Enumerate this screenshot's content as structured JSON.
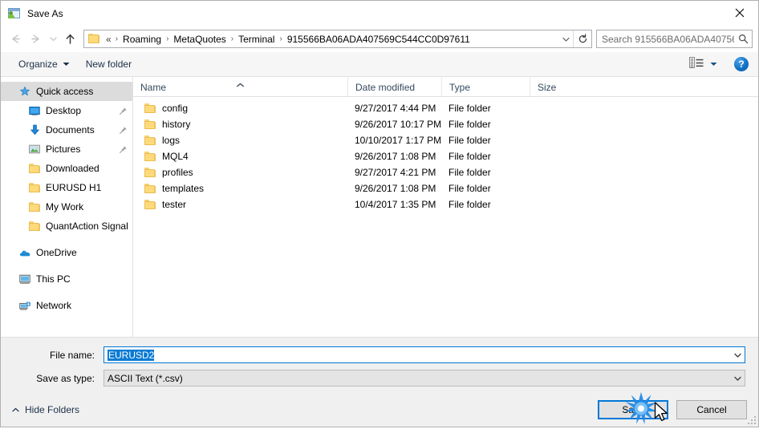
{
  "window": {
    "title": "Save As",
    "icon": "save-as-app-icon",
    "close_label": "×"
  },
  "navigation": {
    "back_icon": "back-arrow-icon",
    "forward_icon": "forward-arrow-icon",
    "recent_icon": "recent-locations-chevron-icon",
    "up_icon": "up-arrow-icon"
  },
  "address": {
    "folder_icon": "folder-icon",
    "lead": "«",
    "crumbs": [
      "Roaming",
      "MetaQuotes",
      "Terminal",
      "915566BA06ADA407569C544CC0D97611"
    ],
    "separator": "›",
    "dropdown_icon": "chevron-down-icon",
    "refresh_icon": "refresh-icon"
  },
  "search": {
    "placeholder": "Search 915566BA06ADA40756...",
    "icon": "search-icon"
  },
  "toolbar": {
    "organize_label": "Organize",
    "organize_caret": "caret-down-icon",
    "new_folder_label": "New folder",
    "view_icon": "view-layout-icon",
    "view_caret": "caret-down-icon",
    "help_label": "?",
    "help_icon": "help-circle-icon"
  },
  "sidebar": {
    "groups": [
      {
        "items": [
          {
            "label": "Quick access",
            "icon": "star-pin-icon",
            "selected": true,
            "pinned": false,
            "indent": 0
          },
          {
            "label": "Desktop",
            "icon": "desktop-icon",
            "selected": false,
            "pinned": true,
            "indent": 1
          },
          {
            "label": "Documents",
            "icon": "documents-download-icon",
            "selected": false,
            "pinned": true,
            "indent": 1
          },
          {
            "label": "Pictures",
            "icon": "pictures-icon",
            "selected": false,
            "pinned": true,
            "indent": 1
          },
          {
            "label": "Downloaded",
            "icon": "folder-icon",
            "selected": false,
            "pinned": false,
            "indent": 1
          },
          {
            "label": "EURUSD H1",
            "icon": "folder-icon",
            "selected": false,
            "pinned": false,
            "indent": 1
          },
          {
            "label": "My Work",
            "icon": "folder-icon",
            "selected": false,
            "pinned": false,
            "indent": 1
          },
          {
            "label": "QuantAction Signal",
            "icon": "folder-icon",
            "selected": false,
            "pinned": false,
            "indent": 1
          }
        ]
      },
      {
        "items": [
          {
            "label": "OneDrive",
            "icon": "onedrive-cloud-icon",
            "selected": false,
            "pinned": false,
            "indent": 0
          }
        ]
      },
      {
        "items": [
          {
            "label": "This PC",
            "icon": "this-pc-monitor-icon",
            "selected": false,
            "pinned": false,
            "indent": 0
          }
        ]
      },
      {
        "items": [
          {
            "label": "Network",
            "icon": "network-icon",
            "selected": false,
            "pinned": false,
            "indent": 0
          }
        ]
      }
    ]
  },
  "filelist": {
    "columns": [
      {
        "key": "name",
        "label": "Name"
      },
      {
        "key": "date",
        "label": "Date modified"
      },
      {
        "key": "type",
        "label": "Type"
      },
      {
        "key": "size",
        "label": "Size"
      }
    ],
    "sort": {
      "column": "Name",
      "direction": "ascending",
      "icon": "sort-ascending-caret-icon"
    },
    "rows": [
      {
        "name": "config",
        "date": "9/27/2017 4:44 PM",
        "type": "File folder",
        "size": "",
        "icon": "folder-icon"
      },
      {
        "name": "history",
        "date": "9/26/2017 10:17 PM",
        "type": "File folder",
        "size": "",
        "icon": "folder-icon"
      },
      {
        "name": "logs",
        "date": "10/10/2017 1:17 PM",
        "type": "File folder",
        "size": "",
        "icon": "folder-icon"
      },
      {
        "name": "MQL4",
        "date": "9/26/2017 1:08 PM",
        "type": "File folder",
        "size": "",
        "icon": "folder-icon"
      },
      {
        "name": "profiles",
        "date": "9/27/2017 4:21 PM",
        "type": "File folder",
        "size": "",
        "icon": "folder-icon"
      },
      {
        "name": "templates",
        "date": "9/26/2017 1:08 PM",
        "type": "File folder",
        "size": "",
        "icon": "folder-icon"
      },
      {
        "name": "tester",
        "date": "10/4/2017 1:35 PM",
        "type": "File folder",
        "size": "",
        "icon": "folder-icon"
      }
    ]
  },
  "form": {
    "filename_label": "File name:",
    "filename_value": "EURUSD2",
    "filename_selected": true,
    "filetype_label": "Save as type:",
    "filetype_value": "ASCII Text (*.csv)",
    "dropdown_icon": "chevron-down-icon"
  },
  "footer": {
    "hide_folders_label": "Hide Folders",
    "hide_folders_caret": "caret-up-icon",
    "save_label": "Save",
    "cancel_label": "Cancel",
    "resize_grip_icon": "resize-grip-icon",
    "click_effect_icon": "click-burst-icon",
    "cursor_icon": "mouse-arrow-cursor-icon"
  },
  "colors": {
    "accent": "#0078d7",
    "selection": "#0a7bd3",
    "folder_yellow": "#ffda7a",
    "chrome_bg": "#f0f0f0",
    "sidebar_selected": "#dcdcdc"
  }
}
